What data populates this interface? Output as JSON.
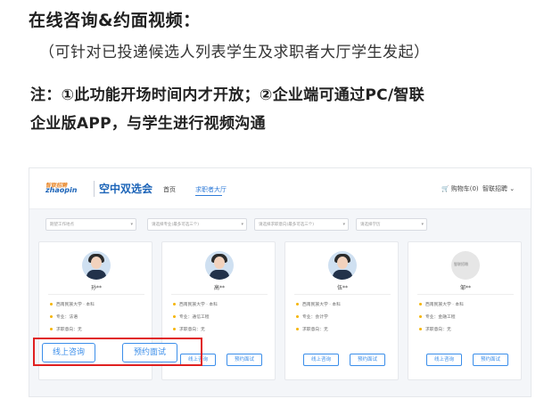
{
  "heading": "在线咨询&约面视频：",
  "subheading": "（可针对已投递候选人列表学生及求职者大厅学生发起）",
  "notes": {
    "line1": "注：①此功能开场时间内才开放；②企业端可通过PC/智联",
    "line2": "企业版APP，与学生进行视频沟通"
  },
  "web": {
    "logo_top": "智联招聘",
    "logo_main": "zhaopin",
    "site_title": "空中双选会",
    "nav": {
      "home": "首页",
      "hall": "求职者大厅"
    },
    "cart": "购物车(0)",
    "user": "智联招聘",
    "filters": [
      "期望工作地点",
      "请选择专业(最多可选三个)",
      "请选择求职意向(最多可选三个)",
      "请选择学历"
    ],
    "row_labels": [
      "西南民族大学",
      "专业：",
      "求职意向："
    ],
    "cards": [
      {
        "name": "孙**",
        "school": "西南民族大学 · 本科",
        "major": "专业：法语",
        "intent": "求职意向：无"
      },
      {
        "name": "高**",
        "school": "西南民族大学 · 本科",
        "major": "专业：通信工程",
        "intent": "求职意向：无"
      },
      {
        "name": "伍**",
        "school": "西南民族大学 · 本科",
        "major": "专业：会计学",
        "intent": "求职意向：无"
      },
      {
        "name": "邹**",
        "school": "西南民族大学 · 本科",
        "major": "专业：金融工程",
        "intent": "求职意向：无"
      }
    ],
    "buttons": {
      "consult": "线上咨询",
      "interview": "预约面试"
    }
  },
  "colors": {
    "accent": "#3b8eea",
    "highlight": "#e02020",
    "bullet": "#f5b400"
  }
}
